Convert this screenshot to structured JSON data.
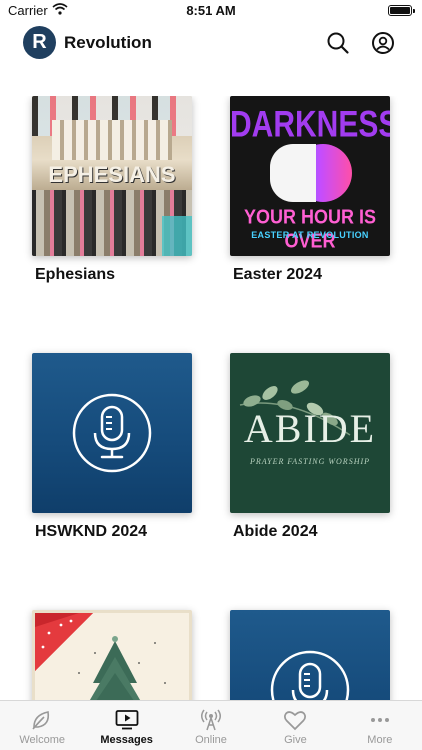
{
  "status_bar": {
    "carrier": "Carrier",
    "time": "8:51 AM",
    "icons": [
      "wifi-icon",
      "battery-icon"
    ]
  },
  "header": {
    "logo_letter": "R",
    "title": "Revolution",
    "brand_color": "#1f3f5f",
    "icons": [
      "search-icon",
      "account-icon"
    ]
  },
  "series": [
    {
      "title": "Ephesians",
      "art": {
        "word": "EPHESIANS"
      }
    },
    {
      "title": "Easter 2024",
      "art": {
        "headline": "DARKNESS",
        "line1": "YOUR HOUR IS OVER",
        "line2": "EASTER AT REVOLUTION"
      }
    },
    {
      "title": "HSWKND 2024",
      "art": {
        "icon": "microphone-icon"
      }
    },
    {
      "title": "Abide 2024",
      "art": {
        "word": "ABIDE",
        "sub": "PRAYER FASTING WORSHIP"
      }
    },
    {
      "title": "",
      "art": {
        "icon": "christmas-tree-icon"
      }
    },
    {
      "title": "",
      "art": {
        "icon": "microphone-icon"
      }
    }
  ],
  "tab_bar": {
    "active_tab": "Messages",
    "tabs": [
      {
        "label": "Welcome",
        "icon": "leaf-icon"
      },
      {
        "label": "Messages",
        "icon": "tv-play-icon"
      },
      {
        "label": "Online",
        "icon": "broadcast-icon"
      },
      {
        "label": "Give",
        "icon": "heart-icon"
      },
      {
        "label": "More",
        "icon": "ellipsis-icon"
      }
    ]
  }
}
